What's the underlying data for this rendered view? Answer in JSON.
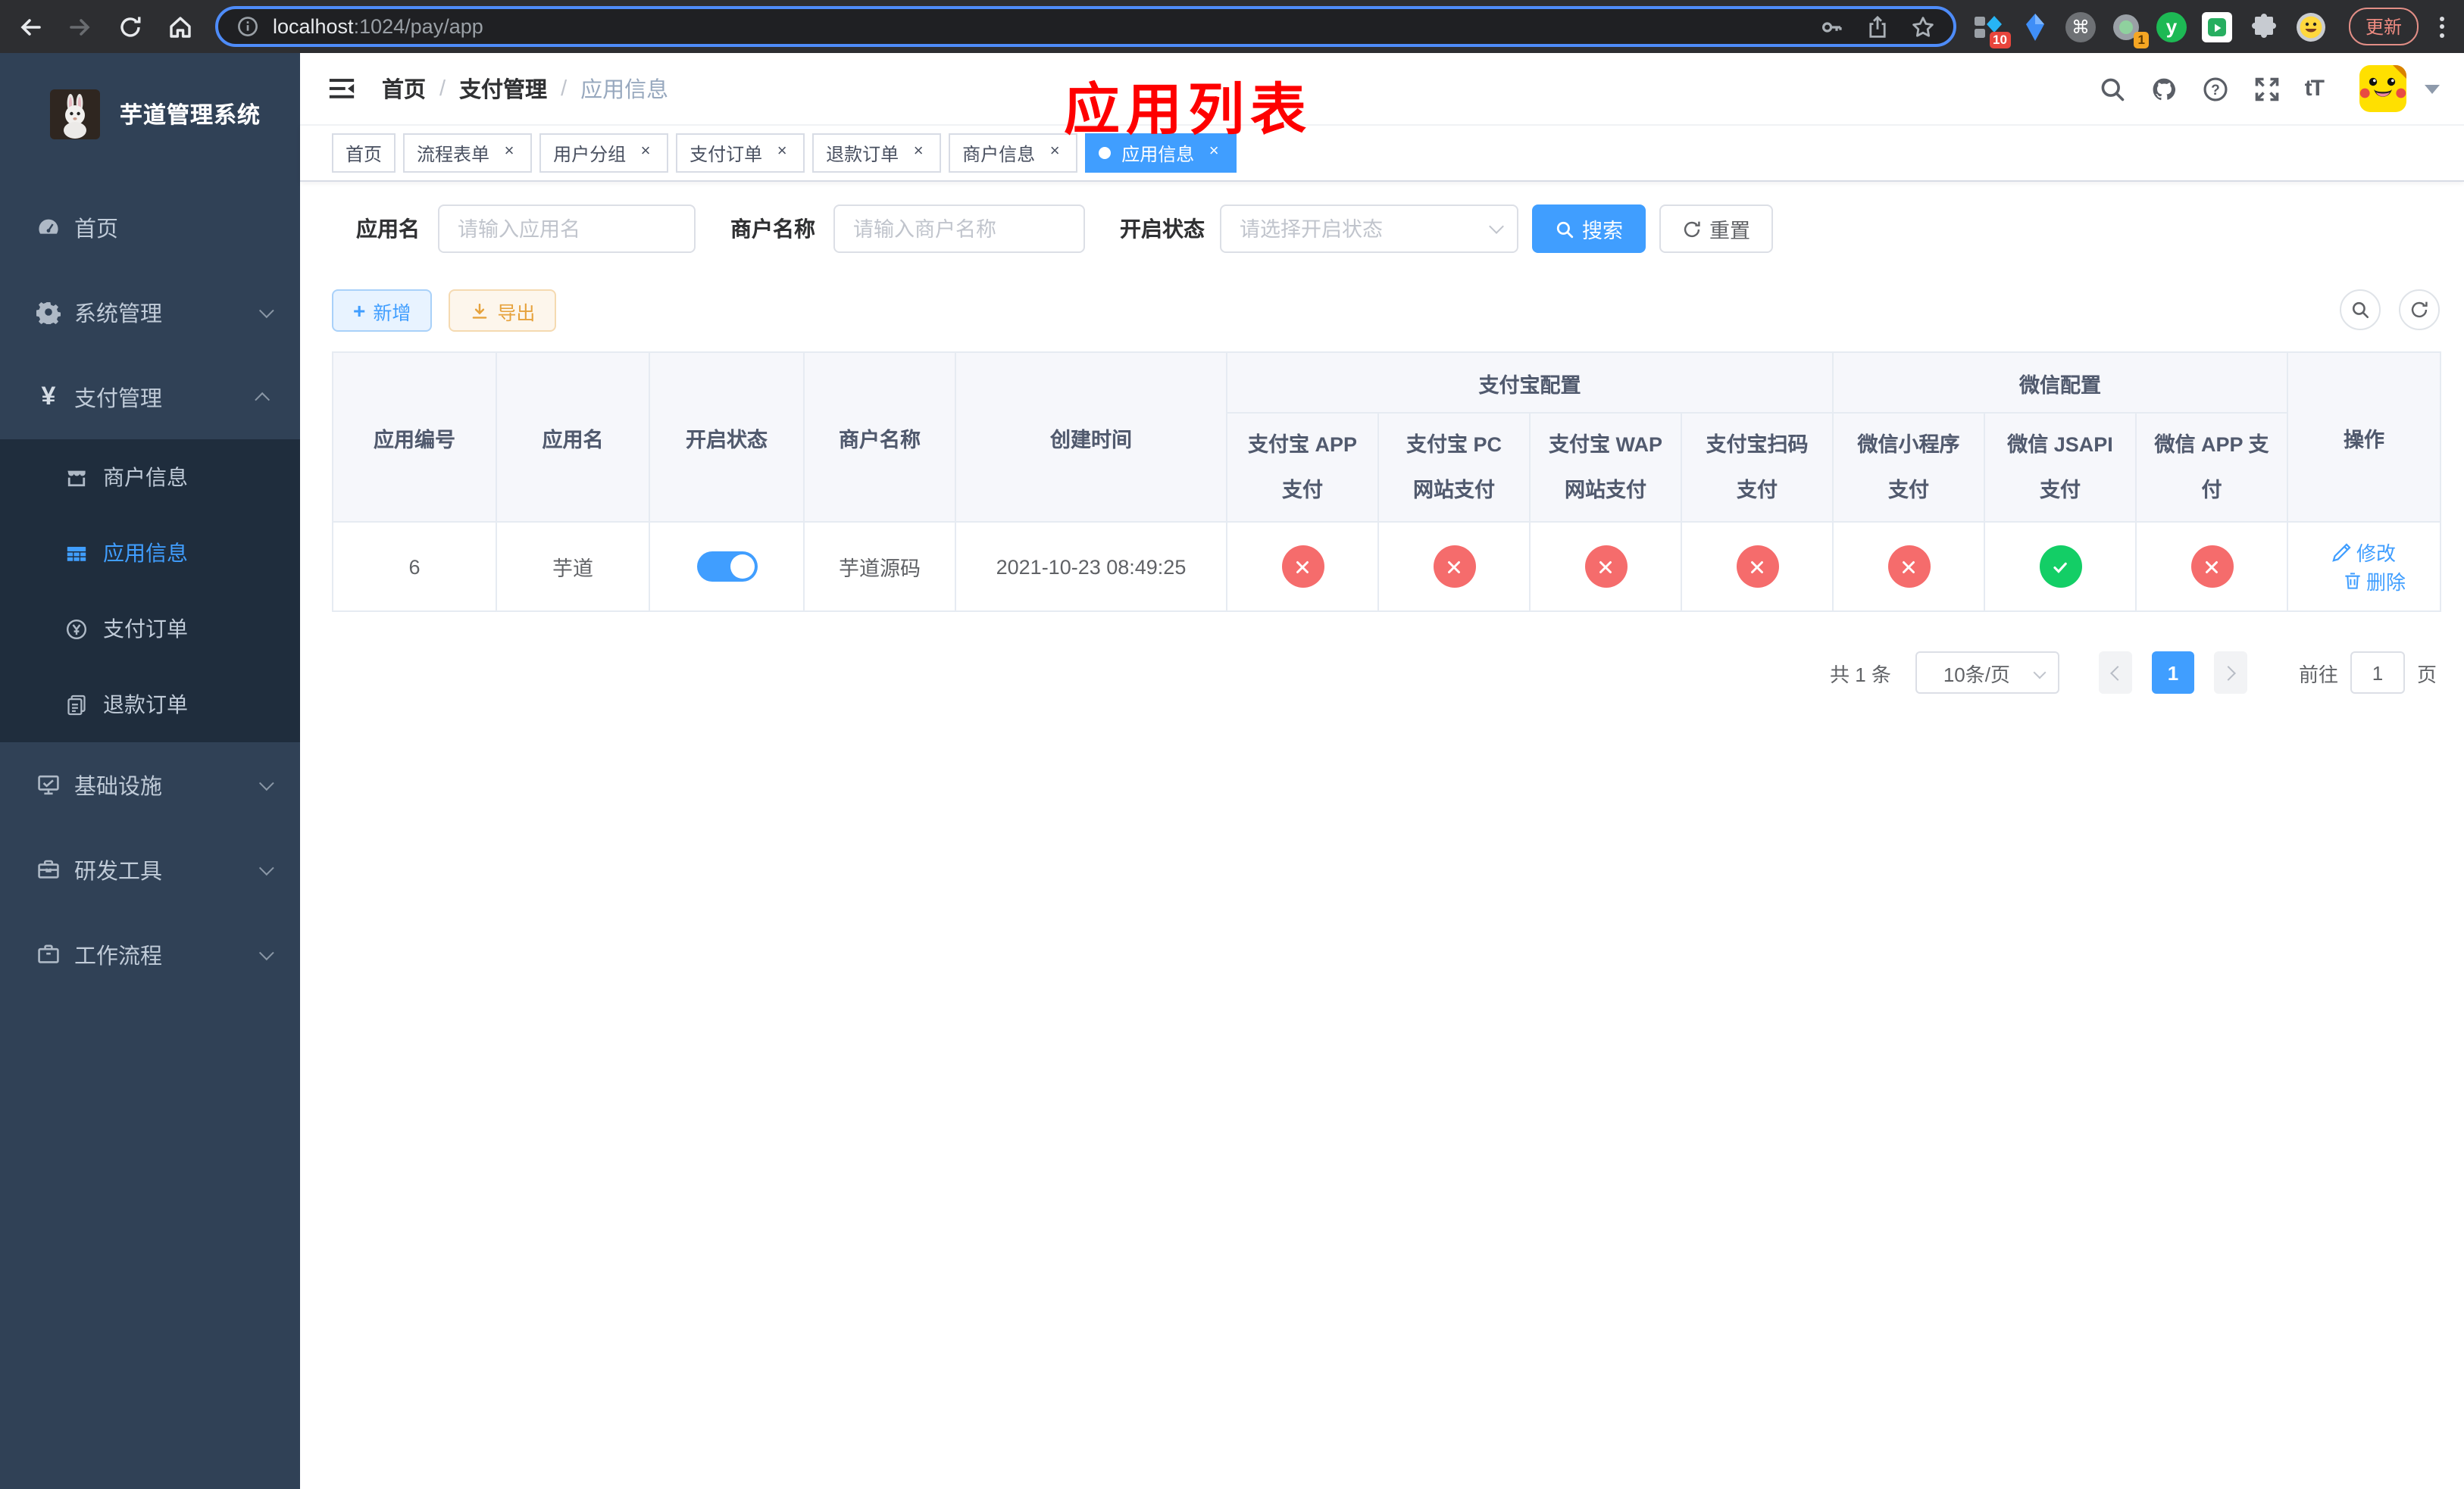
{
  "browser": {
    "url_host": "localhost",
    "url_rest": ":1024/pay/app",
    "update_label": "更新",
    "badges": {
      "sidekick": "10",
      "recorder": "1"
    }
  },
  "sidebar": {
    "title": "芋道管理系统",
    "items": [
      {
        "label": "首页"
      },
      {
        "label": "系统管理"
      },
      {
        "label": "支付管理"
      },
      {
        "label": "商户信息"
      },
      {
        "label": "应用信息"
      },
      {
        "label": "支付订单"
      },
      {
        "label": "退款订单"
      },
      {
        "label": "基础设施"
      },
      {
        "label": "研发工具"
      },
      {
        "label": "工作流程"
      }
    ]
  },
  "header": {
    "breadcrumb": [
      "首页",
      "支付管理",
      "应用信息"
    ],
    "annotation": "应用列表"
  },
  "tabs": [
    {
      "label": "首页"
    },
    {
      "label": "流程表单"
    },
    {
      "label": "用户分组"
    },
    {
      "label": "支付订单"
    },
    {
      "label": "退款订单"
    },
    {
      "label": "商户信息"
    },
    {
      "label": "应用信息"
    }
  ],
  "filters": {
    "app_name_label": "应用名",
    "app_name_placeholder": "请输入应用名",
    "merchant_label": "商户名称",
    "merchant_placeholder": "请输入商户名称",
    "status_label": "开启状态",
    "status_placeholder": "请选择开启状态",
    "search_label": "搜索",
    "reset_label": "重置"
  },
  "toolbar": {
    "add_label": "新增",
    "export_label": "导出"
  },
  "table": {
    "columns": [
      "应用编号",
      "应用名",
      "开启状态",
      "商户名称",
      "创建时间"
    ],
    "groups": {
      "alipay": "支付宝配置",
      "wechat": "微信配置"
    },
    "pay_columns": [
      "支付宝 APP 支付",
      "支付宝 PC 网站支付",
      "支付宝 WAP 网站支付",
      "支付宝扫码支付",
      "微信小程序支付",
      "微信 JSAPI 支付",
      "微信 APP 支付"
    ],
    "actions_label": "操作",
    "row": {
      "id": "6",
      "name": "芋道",
      "enabled": true,
      "merchant": "芋道源码",
      "created_at": "2021-10-23 08:49:25",
      "pay_status": [
        "cross",
        "cross",
        "cross",
        "cross",
        "cross",
        "check",
        "cross"
      ],
      "edit_label": "修改",
      "delete_label": "删除"
    }
  },
  "pagination": {
    "total_label": "共 1 条",
    "page_size_label": "10条/页",
    "current_page": "1",
    "goto_label": "前往",
    "goto_value": "1",
    "page_unit_label": "页"
  },
  "colors": {
    "accent": "#409eff",
    "success": "#13ce66",
    "danger": "#f56c6c",
    "sidebar_bg": "#304156",
    "submenu_bg": "#1f2d3d"
  }
}
